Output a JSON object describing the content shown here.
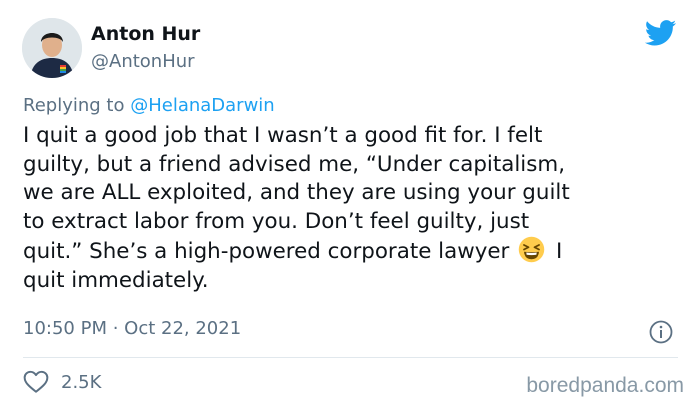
{
  "author": {
    "name": "Anton Hur",
    "handle": "@AntonHur"
  },
  "reply": {
    "prefix": "Replying to ",
    "mention": "@HelanaDarwin"
  },
  "tweet": {
    "lines": [
      "I quit a good job that I wasn’t a good fit for. I felt",
      "guilty, but a friend advised me, “Under capitalism,",
      "we are ALL exploited, and they are using your guilt",
      "to extract labor from you. Don’t feel guilty, just",
      "quit.” She’s a high-powered corporate lawyer",
      "I",
      "quit immediately."
    ],
    "emoji": "laughing-squinting-face"
  },
  "meta": {
    "time": "10:50 PM",
    "separator": " · ",
    "date": "Oct 22, 2021"
  },
  "engagement": {
    "likes": "2.5K"
  },
  "watermark": "boredpanda.com",
  "colors": {
    "brand_blue": "#1da1f2",
    "secondary_text": "#5b7083",
    "primary_text": "#0f1419",
    "divider": "#e1e8ed"
  },
  "icons": [
    "twitter-bird-icon",
    "heart-icon",
    "info-icon",
    "laughing-emoji-icon"
  ]
}
